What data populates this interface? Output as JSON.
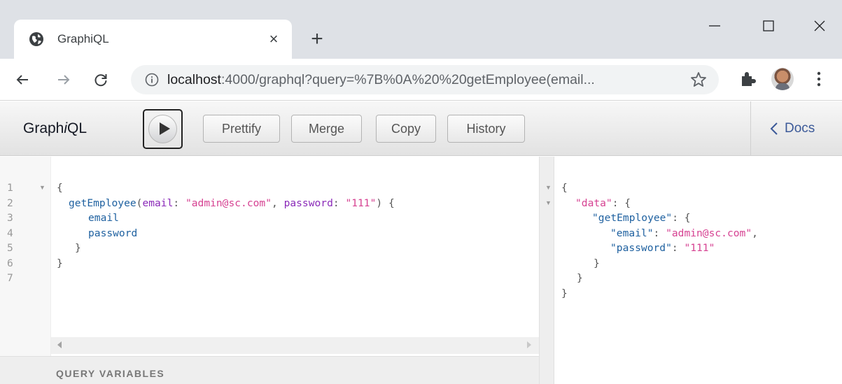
{
  "browser": {
    "tab_title": "GraphiQL",
    "close_glyph": "×",
    "newtab_glyph": "+",
    "url_host": "localhost",
    "url_rest": ":4000/graphql?query=%7B%0A%20%20getEmployee(email...",
    "icons": [
      "globe-icon",
      "close-icon",
      "plus-icon",
      "minimize-icon",
      "maximize-icon",
      "close-window-icon",
      "back-arrow-icon",
      "forward-arrow-icon",
      "reload-icon",
      "info-icon",
      "star-icon",
      "puzzle-icon",
      "kebab-menu-icon"
    ]
  },
  "graphiql": {
    "logo_prefix": "Graph",
    "logo_italic": "i",
    "logo_suffix": "QL",
    "buttons": {
      "prettify": "Prettify",
      "merge": "Merge",
      "copy": "Copy",
      "history": "History"
    },
    "docs": "Docs",
    "query_variables": "QUERY VARIABLES"
  },
  "query": {
    "line_numbers": [
      "1",
      "2",
      "3",
      "4",
      "5",
      "6",
      "7"
    ],
    "lines": {
      "l1": "{",
      "l2_name": "getEmployee",
      "l2_paren": "(",
      "l2_arg1": "email",
      "l2_colon1": ": ",
      "l2_val1": "\"admin@sc.com\"",
      "l2_comma": ", ",
      "l2_arg2": "password",
      "l2_colon2": ": ",
      "l2_val2": "\"111\"",
      "l2_close": ") {",
      "l3": "email",
      "l4": "password",
      "l5": "}",
      "l6": "}"
    }
  },
  "result": {
    "r1": "{",
    "r2_key": "\"data\"",
    "r2_rest": ": {",
    "r3_key": "\"getEmployee\"",
    "r3_rest": ": {",
    "r4_key": "\"email\"",
    "r4_colon": ": ",
    "r4_val": "\"admin@sc.com\"",
    "r4_comma": ",",
    "r5_key": "\"password\"",
    "r5_colon": ": ",
    "r5_val": "\"111\"",
    "r6": "}",
    "r7": "}",
    "r8": "}"
  },
  "colors": {
    "keyword": "#1f61a0",
    "attribute": "#8b2bb9",
    "string": "#d64292",
    "docs_link": "#3b5998"
  }
}
